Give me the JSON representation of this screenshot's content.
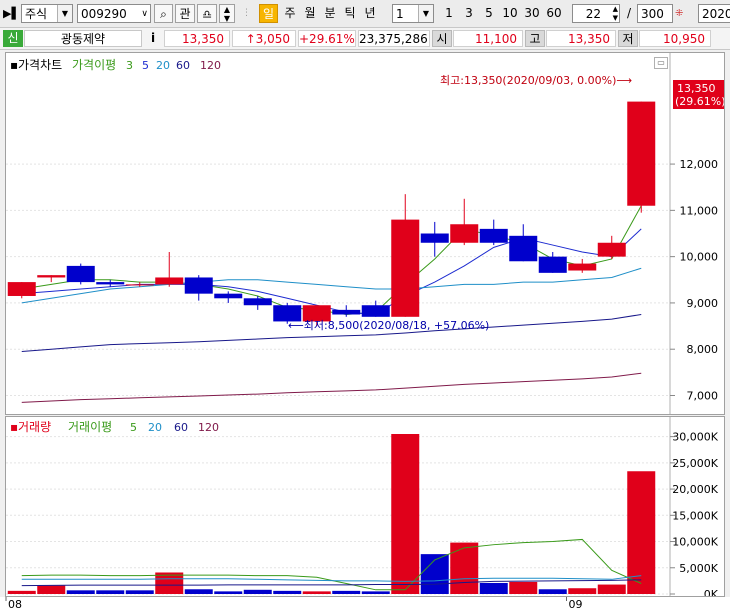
{
  "toolbar": {
    "market": "주식",
    "code": "009290",
    "btn_gwan": "관",
    "period_day": "일",
    "period_week": "주",
    "period_month": "월",
    "period_min": "분",
    "period_tick": "틱",
    "period_year": "년",
    "unit_value": "1",
    "quick": [
      "1",
      "3",
      "5",
      "10",
      "30",
      "60"
    ],
    "count_value": "22",
    "slash": "/",
    "total_value": "300",
    "date_value": "2020/"
  },
  "info": {
    "credit": "신",
    "name": "광동제약",
    "info_btn": "i",
    "price": "13,350",
    "change": "↑3,050",
    "rate": "+29.61%",
    "volume": "23,375,286",
    "open_label": "시",
    "open": "11,100",
    "high_label": "고",
    "high": "13,350",
    "low_label": "저",
    "low": "10,950"
  },
  "price_chart": {
    "legend_title": "가격차트",
    "legend_ma": "가격이평",
    "legend_periods": [
      "3",
      "5",
      "20",
      "60",
      "120"
    ],
    "max_label": "최고:13,350(2020/09/03, 0.00%)⟶",
    "min_label": "⟵최저:8,500(2020/08/18, +57.06%)",
    "last_price": "13,350",
    "last_rate": "(29.61%)"
  },
  "volume_chart": {
    "legend_title": "거래량",
    "legend_ma": "거래이평",
    "legend_periods": [
      "5",
      "20",
      "60",
      "120"
    ]
  },
  "colors": {
    "up": "#e0001a",
    "down": "#0000cc",
    "ma3": "#3a9a1a",
    "ma5": "#1d2bd0",
    "ma20": "#1f8fc8",
    "ma60": "#18188a",
    "ma120": "#801a4a"
  },
  "chart_data": [
    {
      "type": "candlestick",
      "title": "가격차트",
      "ylim": [
        6600,
        14400
      ],
      "yticks": [
        7000,
        8000,
        9000,
        10000,
        11000,
        12000
      ],
      "ytick_labels": [
        "7,000",
        "8,000",
        "9,000",
        "10,000",
        "11,000",
        "12,000"
      ],
      "x_month_labels": [
        {
          "index": 0,
          "label": "08"
        },
        {
          "index": 19,
          "label": "09"
        }
      ],
      "candles": [
        {
          "o": 9150,
          "h": 9450,
          "l": 9100,
          "c": 9450
        },
        {
          "o": 9550,
          "h": 9600,
          "l": 9450,
          "c": 9600
        },
        {
          "o": 9800,
          "h": 9850,
          "l": 9400,
          "c": 9450
        },
        {
          "o": 9450,
          "h": 9500,
          "l": 9350,
          "c": 9400
        },
        {
          "o": 9400,
          "h": 9450,
          "l": 9350,
          "c": 9400
        },
        {
          "o": 9400,
          "h": 10100,
          "l": 9350,
          "c": 9550
        },
        {
          "o": 9550,
          "h": 9600,
          "l": 9050,
          "c": 9200
        },
        {
          "o": 9200,
          "h": 9250,
          "l": 9000,
          "c": 9100
        },
        {
          "o": 9100,
          "h": 9150,
          "l": 8850,
          "c": 8950
        },
        {
          "o": 8950,
          "h": 9000,
          "l": 8550,
          "c": 8600
        },
        {
          "o": 8600,
          "h": 8950,
          "l": 8500,
          "c": 8950
        },
        {
          "o": 8850,
          "h": 8950,
          "l": 8700,
          "c": 8750
        },
        {
          "o": 8950,
          "h": 9050,
          "l": 8700,
          "c": 8700
        },
        {
          "o": 8700,
          "h": 11350,
          "l": 8700,
          "c": 10800
        },
        {
          "o": 10500,
          "h": 10750,
          "l": 10000,
          "c": 10300
        },
        {
          "o": 10300,
          "h": 11250,
          "l": 10250,
          "c": 10700
        },
        {
          "o": 10600,
          "h": 10800,
          "l": 10250,
          "c": 10300
        },
        {
          "o": 10450,
          "h": 10700,
          "l": 9900,
          "c": 9900
        },
        {
          "o": 10000,
          "h": 10100,
          "l": 9650,
          "c": 9650
        },
        {
          "o": 9700,
          "h": 9950,
          "l": 9650,
          "c": 9850
        },
        {
          "o": 10000,
          "h": 10450,
          "l": 9950,
          "c": 10300
        },
        {
          "o": 11100,
          "h": 13350,
          "l": 10950,
          "c": 13350
        }
      ],
      "series": [
        {
          "name": "3",
          "values": [
            9300,
            9400,
            9500,
            9500,
            9450,
            9450,
            9400,
            9300,
            9150,
            8900,
            8850,
            8750,
            8800,
            9400,
            9950,
            10600,
            10450,
            10300,
            9950,
            9800,
            9950,
            11100
          ]
        },
        {
          "name": "5",
          "values": [
            9200,
            9250,
            9300,
            9350,
            9400,
            9400,
            9400,
            9350,
            9250,
            9100,
            8950,
            8800,
            8750,
            9150,
            9450,
            9800,
            10200,
            10400,
            10250,
            10100,
            10000,
            10600
          ]
        },
        {
          "name": "20",
          "values": [
            9000,
            9100,
            9200,
            9300,
            9350,
            9400,
            9450,
            9500,
            9500,
            9450,
            9400,
            9350,
            9300,
            9300,
            9350,
            9400,
            9400,
            9450,
            9450,
            9500,
            9550,
            9750
          ]
        },
        {
          "name": "60",
          "values": [
            7950,
            8000,
            8050,
            8100,
            8120,
            8140,
            8160,
            8190,
            8220,
            8250,
            8270,
            8290,
            8310,
            8350,
            8400,
            8440,
            8480,
            8520,
            8560,
            8600,
            8650,
            8750
          ]
        },
        {
          "name": "120",
          "values": [
            6850,
            6880,
            6910,
            6930,
            6950,
            6970,
            6990,
            7010,
            7030,
            7060,
            7080,
            7100,
            7120,
            7160,
            7200,
            7240,
            7270,
            7300,
            7330,
            7360,
            7400,
            7480
          ]
        }
      ]
    },
    {
      "type": "bar",
      "title": "거래량",
      "ylim": [
        0,
        30500
      ],
      "yticks": [
        0,
        5000,
        10000,
        15000,
        20000,
        25000,
        30000
      ],
      "ytick_labels": [
        "0K",
        "5,000K",
        "10,000K",
        "15,000K",
        "20,000K",
        "25,000K",
        "30,000K"
      ],
      "values": [
        600,
        1600,
        700,
        700,
        700,
        4100,
        900,
        500,
        800,
        600,
        500,
        600,
        500,
        30500,
        7600,
        9800,
        2100,
        2300,
        900,
        1100,
        1800,
        23400
      ],
      "directions": [
        "up",
        "up",
        "down",
        "down",
        "down",
        "up",
        "down",
        "down",
        "down",
        "down",
        "up",
        "down",
        "down",
        "up",
        "down",
        "up",
        "down",
        "up",
        "down",
        "up",
        "up",
        "up"
      ],
      "series": [
        {
          "name": "5",
          "values": [
            3500,
            3600,
            3600,
            3500,
            3500,
            3600,
            3600,
            3600,
            3500,
            3500,
            3200,
            2000,
            800,
            800,
            6500,
            8800,
            9400,
            9800,
            10000,
            10400,
            4500,
            2000
          ]
        },
        {
          "name": "20",
          "values": [
            2800,
            2800,
            2800,
            2800,
            2800,
            2900,
            2900,
            2900,
            2800,
            2700,
            2600,
            2500,
            2500,
            2400,
            2500,
            2900,
            3000,
            3000,
            3000,
            2900,
            2800,
            3500
          ]
        },
        {
          "name": "60",
          "values": [
            1600,
            1650,
            1700,
            1700,
            1700,
            1700,
            1700,
            1750,
            1750,
            1750,
            1750,
            1750,
            1800,
            1800,
            1850,
            2200,
            2400,
            2450,
            2500,
            2550,
            2600,
            2700
          ]
        }
      ]
    }
  ]
}
